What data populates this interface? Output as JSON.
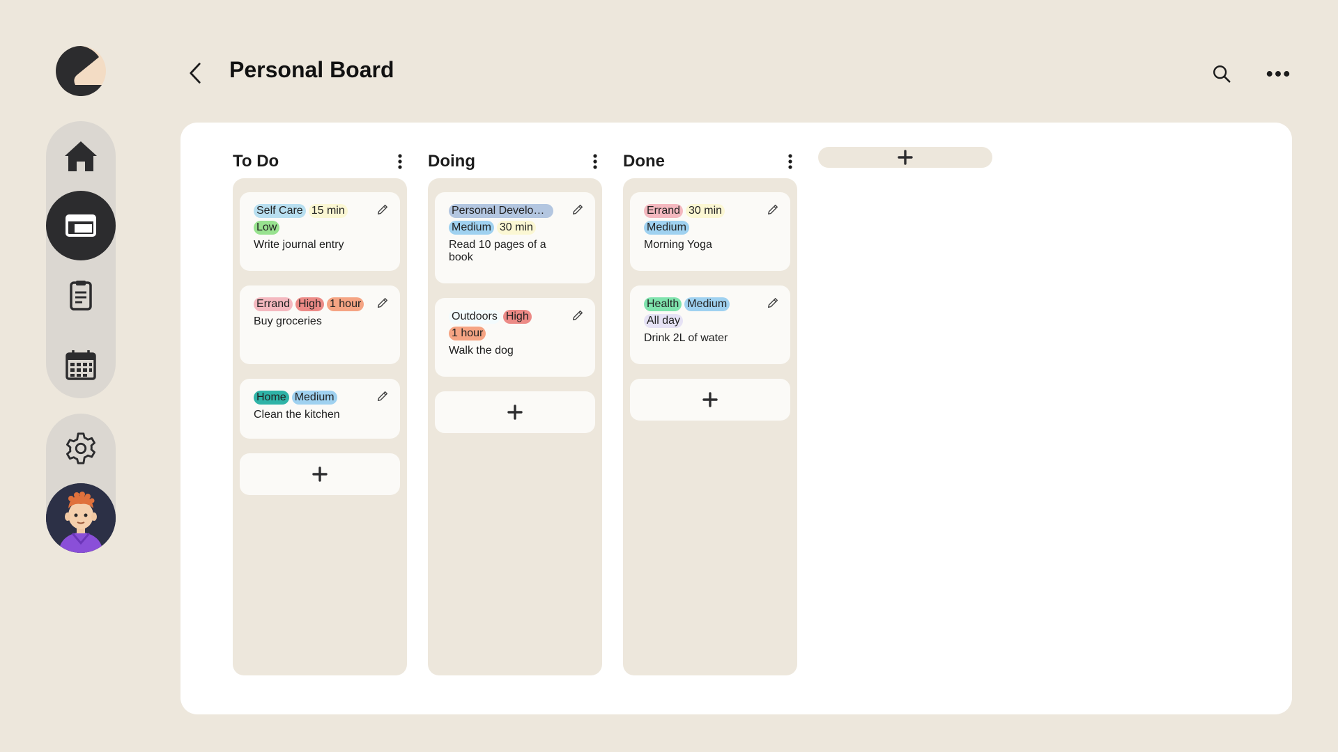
{
  "header": {
    "title": "Personal Board"
  },
  "sidebar": {
    "items": [
      {
        "icon": "home-icon"
      },
      {
        "icon": "board-icon",
        "active": true
      },
      {
        "icon": "notes-icon"
      },
      {
        "icon": "calendar-icon"
      }
    ],
    "settings_icon": "gear-icon",
    "avatar_icon": "avatar"
  },
  "colors": {
    "background": "#ede7dc",
    "panel": "#ffffff",
    "dark": "#2c2c2e",
    "tag_selfcare": "#b8dff0",
    "tag_time": "#fbf7d3",
    "tag_low": "#98e28f",
    "tag_errand": "#f4b8bf",
    "tag_high": "#ec8a86",
    "tag_hour": "#f5a483",
    "tag_home": "#2fb3a7",
    "tag_medium": "#9fd1f0",
    "tag_personal": "#b3c6e0",
    "tag_outdoors": "#f3fbfd",
    "tag_health": "#7fe3ad",
    "tag_allday": "#e6e2f5"
  },
  "columns": [
    {
      "title": "To Do",
      "cards": [
        {
          "tags": [
            {
              "text": "Self Care",
              "color": "#b8dff0"
            },
            {
              "text": "15 min",
              "color": "#fbf7d3"
            },
            {
              "text": "Low",
              "color": "#98e28f"
            }
          ],
          "title": "Write journal entry"
        },
        {
          "tags": [
            {
              "text": "Errand",
              "color": "#f4b8bf"
            },
            {
              "text": "High",
              "color": "#ec8a86"
            },
            {
              "text": "1 hour",
              "color": "#f5a483"
            }
          ],
          "title": "Buy groceries"
        },
        {
          "tags": [
            {
              "text": "Home",
              "color": "#2fb3a7"
            },
            {
              "text": "Medium",
              "color": "#9fd1f0"
            }
          ],
          "title": "Clean the kitchen"
        }
      ]
    },
    {
      "title": "Doing",
      "cards": [
        {
          "tags": [
            {
              "text": "Personal Development",
              "color": "#b3c6e0"
            },
            {
              "text": "Medium",
              "color": "#9fd1f0"
            },
            {
              "text": "30 min",
              "color": "#fbf7d3"
            }
          ],
          "title": "Read 10 pages of a book"
        },
        {
          "tags": [
            {
              "text": "Outdoors",
              "color": "#f3fbfd"
            },
            {
              "text": "High",
              "color": "#ec8a86"
            },
            {
              "text": "1 hour",
              "color": "#f5a483"
            }
          ],
          "title": "Walk the dog"
        }
      ]
    },
    {
      "title": "Done",
      "cards": [
        {
          "tags": [
            {
              "text": "Errand",
              "color": "#f4b8bf"
            },
            {
              "text": "30 min",
              "color": "#fbf7d3"
            },
            {
              "text": "Medium",
              "color": "#9fd1f0"
            }
          ],
          "title": "Morning Yoga"
        },
        {
          "tags": [
            {
              "text": "Health",
              "color": "#7fe3ad"
            },
            {
              "text": "Medium",
              "color": "#9fd1f0"
            },
            {
              "text": "All day",
              "color": "#e6e2f5"
            }
          ],
          "title": "Drink 2L of water"
        }
      ]
    }
  ]
}
